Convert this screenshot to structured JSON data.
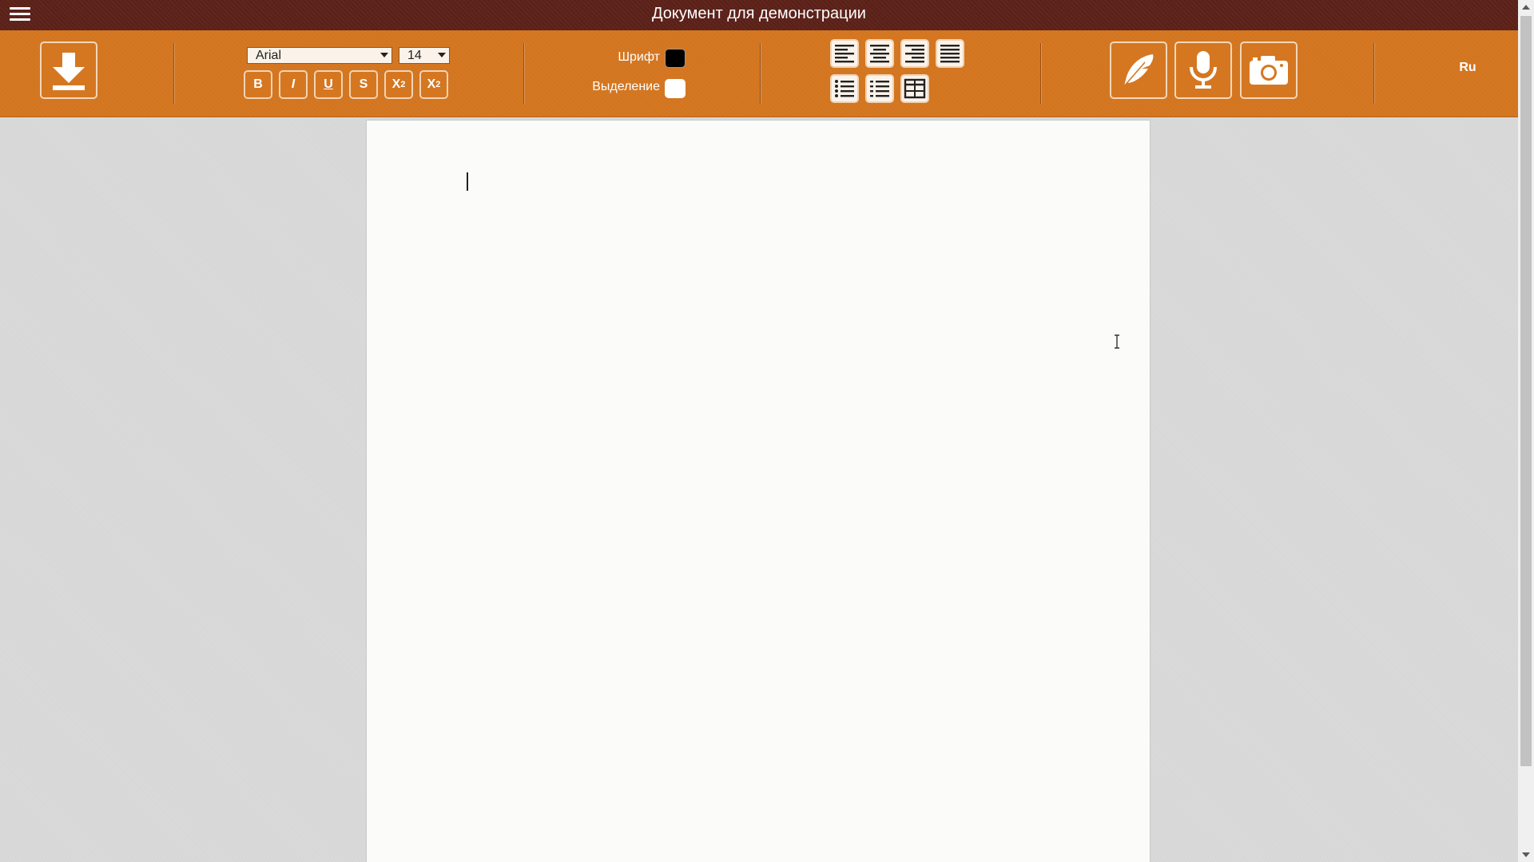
{
  "window": {
    "title": "Документ для демонстрации"
  },
  "toolbar": {
    "font_family": "Arial",
    "font_size": "14",
    "format_buttons": {
      "bold": "B",
      "italic": "I",
      "underline": "U",
      "strikethrough": "S",
      "subscript_base": "X",
      "subscript_mark": "2",
      "superscript_base": "X",
      "superscript_mark": "2"
    },
    "font_color_label": "Шрифт",
    "font_color": "#000000",
    "highlight_label": "Выделение",
    "highlight_color": "#ffffff",
    "language": "Ru"
  },
  "colors": {
    "titlebar": "#5a2018",
    "toolbar": "#d67822",
    "workspace": "#dadada",
    "page": "#fbfbfa"
  },
  "icons": [
    "menu-icon",
    "download-icon",
    "align-left-icon",
    "align-center-icon",
    "align-right-icon",
    "align-justify-icon",
    "bulleted-list-icon",
    "numbered-list-icon",
    "table-icon",
    "feather-icon",
    "microphone-icon",
    "camera-icon"
  ]
}
